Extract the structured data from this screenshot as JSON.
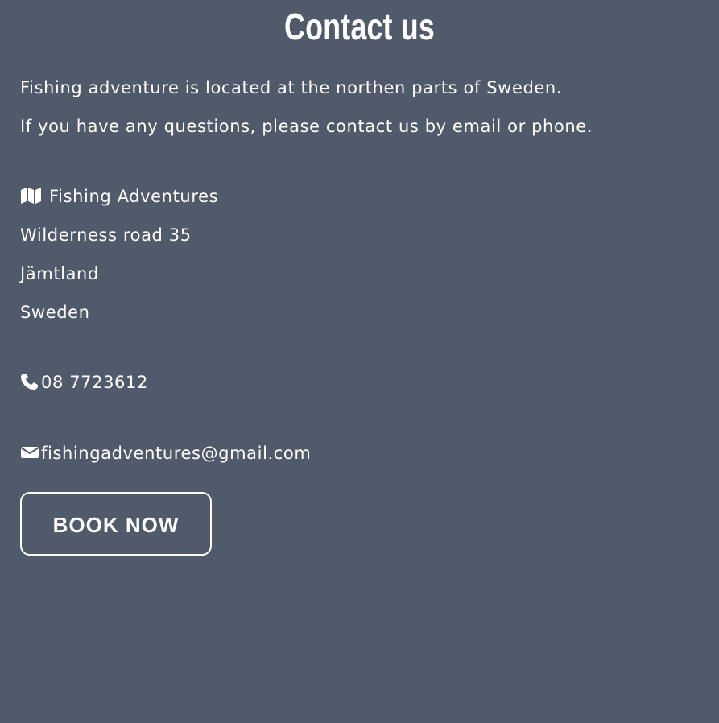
{
  "page": {
    "title": "Contact us",
    "intro_line_1": "Fishing adventure is located at the northen parts of Sweden.",
    "intro_line_2": "If you have any questions, please contact us by email or phone."
  },
  "contact": {
    "address": {
      "icon": "map-icon",
      "name": "Fishing Adventures",
      "road": "Wilderness road 35",
      "region": "Jämtland",
      "country": "Sweden"
    },
    "phone": {
      "icon": "phone-icon",
      "value": "08 7723612"
    },
    "email": {
      "icon": "mail-icon",
      "value": "fishingadventures@gmail.com"
    }
  },
  "cta": {
    "label": "BOOK NOW"
  },
  "colors": {
    "background": "#515a6b",
    "text": "#ffffff",
    "button_border": "#ffffff"
  }
}
